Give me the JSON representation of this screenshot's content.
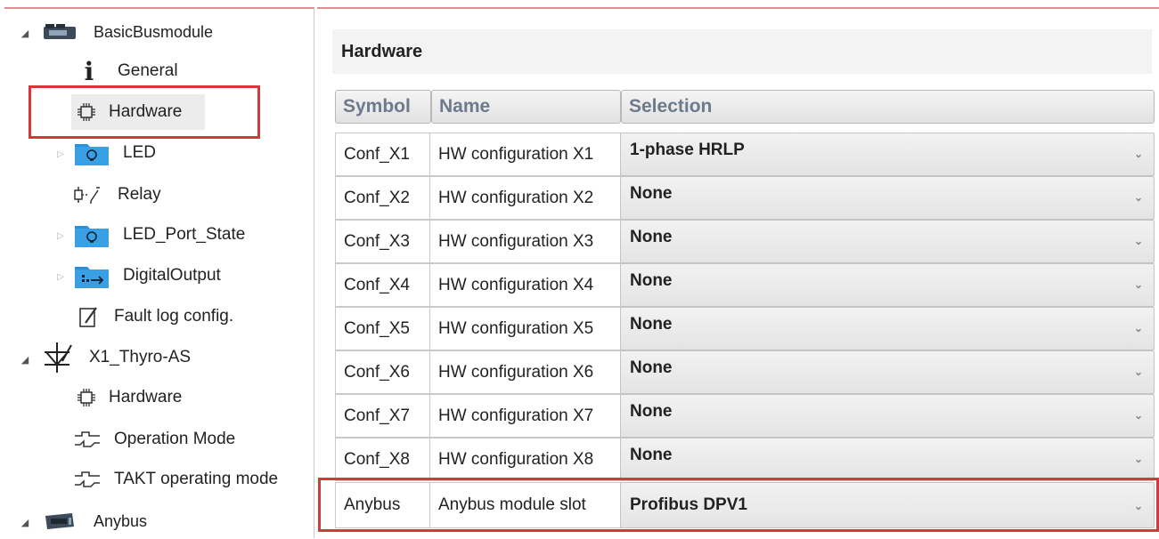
{
  "tree": {
    "items": [
      {
        "label": "BasicBusmodule",
        "icon": "module-device-icon"
      },
      {
        "label": "General",
        "icon": "info-icon"
      },
      {
        "label": "Hardware",
        "icon": "chip-icon"
      },
      {
        "label": "LED",
        "icon": "led-folder-icon"
      },
      {
        "label": "Relay",
        "icon": "relay-icon"
      },
      {
        "label": "LED_Port_State",
        "icon": "led-folder-icon"
      },
      {
        "label": "DigitalOutput",
        "icon": "digital-output-folder-icon"
      },
      {
        "label": "Fault log config.",
        "icon": "edit-note-icon"
      },
      {
        "label": "X1_Thyro-AS",
        "icon": "thyristor-icon"
      },
      {
        "label": "Hardware",
        "icon": "chip-icon"
      },
      {
        "label": "Operation Mode",
        "icon": "waveform-icon"
      },
      {
        "label": "TAKT operating mode",
        "icon": "waveform-icon"
      },
      {
        "label": "Anybus",
        "icon": "anybus-device-icon"
      }
    ]
  },
  "panel": {
    "title": "Hardware",
    "columns": {
      "symbol": "Symbol",
      "name": "Name",
      "selection": "Selection"
    },
    "rows": [
      {
        "symbol": "Conf_X1",
        "name": "HW configuration X1",
        "selection": "1-phase HRLP"
      },
      {
        "symbol": "Conf_X2",
        "name": "HW configuration X2",
        "selection": "None"
      },
      {
        "symbol": "Conf_X3",
        "name": "HW configuration X3",
        "selection": "None"
      },
      {
        "symbol": "Conf_X4",
        "name": "HW configuration X4",
        "selection": "None"
      },
      {
        "symbol": "Conf_X5",
        "name": "HW configuration X5",
        "selection": "None"
      },
      {
        "symbol": "Conf_X6",
        "name": "HW configuration X6",
        "selection": "None"
      },
      {
        "symbol": "Conf_X7",
        "name": "HW configuration X7",
        "selection": "None"
      },
      {
        "symbol": "Conf_X8",
        "name": "HW configuration X8",
        "selection": "None"
      },
      {
        "symbol": "Anybus",
        "name": "Anybus module slot",
        "selection": "Profibus DPV1"
      }
    ]
  },
  "colors": {
    "highlight": "#d23a3a",
    "header_text": "#6c7a8c",
    "led_icon": "#2b8fd6"
  }
}
